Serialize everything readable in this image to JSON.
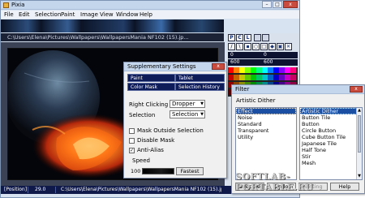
{
  "window": {
    "title": "Pixia",
    "min": "–",
    "max": "□",
    "close": "x"
  },
  "menu": [
    "File",
    "Edit",
    "Selection",
    "Paint",
    "Image",
    "View",
    "Window",
    "Help"
  ],
  "path": "C:\\Users\\Elena\\Pictures\\Wallpapers\\WallpapersMania NF102 (15).jp...",
  "status": {
    "position_label": "[Position]",
    "position_value": "29.0",
    "path": "C:\\Users\\Elena\\Pictures\\Wallpapers\\WallpapersMania NF102 (15).jpg"
  },
  "palette": {
    "tool_letters": [
      "P",
      "C",
      "L"
    ],
    "values": [
      "0",
      "0",
      "600",
      "600"
    ]
  },
  "supplementary": {
    "title": "Supplementary Settings",
    "close": "x",
    "tabs": [
      "Paint",
      "Tablet",
      "Color Mask",
      "Selection History"
    ],
    "right_clicking_label": "Right Clicking",
    "right_clicking_value": "Dropper",
    "selection_label": "Selection",
    "selection_value": "Selection",
    "mask_outside": "Mask Outside Selection",
    "disable_mask": "Disable Mask",
    "anti_alias": "Anti-Alias",
    "anti_alias_checked": true,
    "speed_label": "Speed",
    "speed_value": "100",
    "fastest_button": "Fastest"
  },
  "filter": {
    "title": "Filter",
    "close": "x",
    "current": "Artistic Dither",
    "categories": [
      "Effect",
      "Noise",
      "Standard",
      "Transparent",
      "Utility"
    ],
    "selected_category": "Effect",
    "filters": [
      "Artistic Dither",
      "Button Tile",
      "Button",
      "Circle Button",
      "Cube Button Tile",
      "Japanese Tile",
      "Half Tone",
      "Stir",
      "Mesh"
    ],
    "selected_filter": "Artistic Dither",
    "buttons": [
      "Execute",
      "Undo",
      "Setting",
      "Help"
    ]
  },
  "watermark": "SOFTLAB-PORTABLE.RU"
}
